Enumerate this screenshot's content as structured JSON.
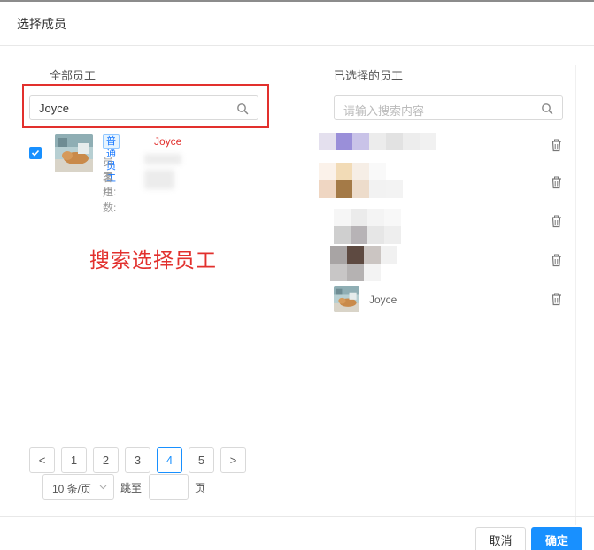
{
  "dialog": {
    "title": "选择成员"
  },
  "left_panel": {
    "title": "全部员工",
    "search": {
      "value": "Joyce",
      "icon": "search-icon"
    },
    "employee": {
      "tag": "普通员工",
      "name": "Joyce",
      "group_label": "员工组:",
      "customers_label": "客户数:",
      "checked": true
    },
    "annotation": "搜索选择员工",
    "pagination": {
      "prev": "<",
      "pages": [
        "1",
        "2",
        "3",
        "4",
        "5"
      ],
      "current": "4",
      "next": ">",
      "page_size": "10 条/页",
      "jump_label": "跳至",
      "page_label": "页"
    }
  },
  "right_panel": {
    "title": "已选择的员工",
    "search": {
      "placeholder": "请输入搜索内容",
      "icon": "search-icon"
    },
    "selected": [
      {
        "name": ""
      },
      {
        "name": ""
      },
      {
        "name": ""
      },
      {
        "name": ""
      },
      {
        "name": "Joyce"
      }
    ],
    "accent_color": "#1890ff"
  },
  "footer": {
    "cancel": "取消",
    "confirm": "确定"
  },
  "colors": {
    "primary": "#1890ff",
    "annotation_red": "#e2302d"
  }
}
